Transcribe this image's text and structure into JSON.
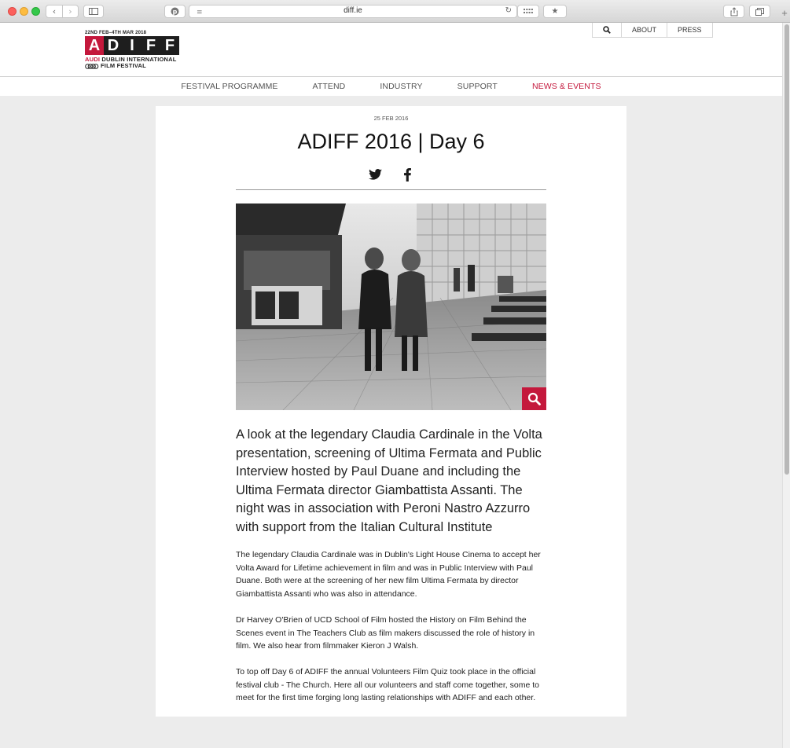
{
  "browser": {
    "url": "diff.ie",
    "back_icon": "chevron-left-icon",
    "forward_icon": "chevron-right-icon",
    "sidebar_icon": "sidebar-icon",
    "pinterest_icon": "pinterest-icon",
    "reader_icon": "reader-icon",
    "reload_icon": "reload-icon",
    "grid_icon": "grid-icon",
    "bookmark_icon": "star-icon",
    "share_icon": "share-icon",
    "tabs_icon": "tabs-icon",
    "new_tab": "+"
  },
  "header": {
    "logo": {
      "dates": "22ND FEB–4TH MAR 2018",
      "letters": [
        "A",
        "D",
        "I",
        "F",
        "F"
      ],
      "line1_brand": "AUDI",
      "line1_rest": " DUBLIN INTERNATIONAL",
      "line2": "FILM FESTIVAL"
    },
    "utility_nav": {
      "about": "ABOUT",
      "press": "PRESS"
    },
    "main_nav": [
      {
        "label": "FESTIVAL PROGRAMME",
        "active": false
      },
      {
        "label": "ATTEND",
        "active": false
      },
      {
        "label": "INDUSTRY",
        "active": false
      },
      {
        "label": "SUPPORT",
        "active": false
      },
      {
        "label": "NEWS & EVENTS",
        "active": true
      }
    ]
  },
  "article": {
    "date": "25 FEB 2016",
    "title": "ADIFF 2016 | Day 6",
    "lead": "A look at the legendary Claudia Cardinale in the Volta presentation, screening of Ultima Fermata and Public Interview hosted by Paul Duane and including the Ultima Fermata director Giambattista Assanti. The night was in association with Peroni Nastro Azzurro with support from the Italian Cultural Institute",
    "paragraphs": [
      "The legendary Claudia Cardinale was in Dublin's Light House Cinema to accept her Volta Award for Lifetime achievement in film and was in Public Interview with Paul Duane. Both were at the screening of her new film Ultima Fermata by director Giambattista Assanti who was also in attendance.",
      "Dr Harvey O'Brien of UCD School of Film hosted the History on Film Behind the Scenes event in The Teachers Club as film makers discussed the role of history in film. We also hear from filmmaker Kieron J Walsh.",
      "To top off Day 6 of ADIFF the annual Volunteers Film Quiz took place in the official festival club - The Church. Here all our volunteers and staff come together, some to meet for the first time forging long lasting relationships with ADIFF and each other."
    ]
  },
  "colors": {
    "brand_red": "#c4183c",
    "page_bg": "#ececec"
  }
}
